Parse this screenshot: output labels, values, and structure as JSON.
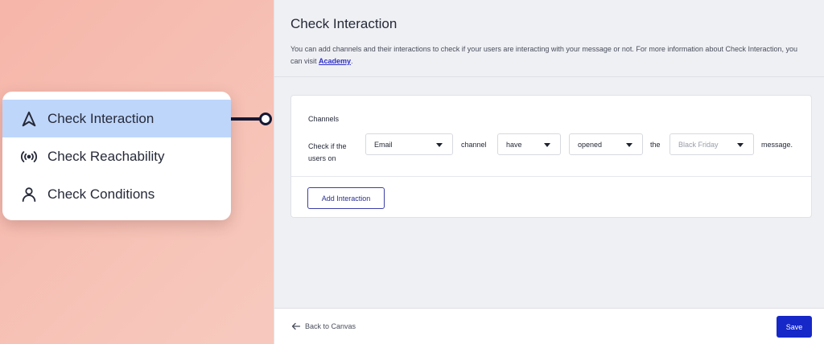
{
  "menu": {
    "items": [
      {
        "label": "Check Interaction",
        "icon": "navigation-arrow-icon",
        "active": true
      },
      {
        "label": "Check Reachability",
        "icon": "broadcast-icon",
        "active": false
      },
      {
        "label": "Check Conditions",
        "icon": "person-icon",
        "active": false
      }
    ]
  },
  "panel": {
    "title": "Check Interaction",
    "description_prefix": "You can add channels and their interactions to check if your users are interacting with your message or not. For more information about Check Interaction, you can visit ",
    "academy_link": "Academy",
    "description_suffix": "."
  },
  "channels": {
    "label": "Channels",
    "check_label": "Check if the users on",
    "channel_select": "Email",
    "word_channel": "channel",
    "condition_select": "have",
    "action_select": "opened",
    "word_the": "the",
    "message_select_placeholder": "Black Friday",
    "word_message": "message.",
    "add_button": "Add Interaction"
  },
  "footer": {
    "back_label": "Back to Canvas",
    "save_label": "Save"
  },
  "colors": {
    "active_menu": "#bfd6fb",
    "primary": "#1628c8",
    "connector": "#141833"
  }
}
